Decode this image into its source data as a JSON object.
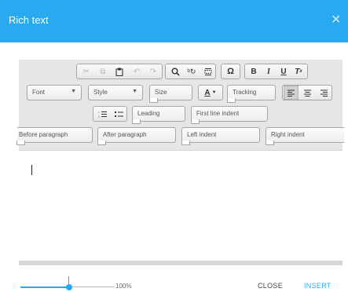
{
  "dialog": {
    "title": "Rich text"
  },
  "toolbar": {
    "font": "Font",
    "style": "Style",
    "size": "Size",
    "tracking": "Tracking",
    "leading": "Leading",
    "first_line_indent": "First line indent",
    "before_paragraph": "Before paragraph",
    "after_paragraph": "After paragraph",
    "left_indent": "Left indent",
    "right_indent": "Right indent",
    "bold": "B",
    "italic": "I",
    "underline": "U",
    "omega": "Ω",
    "text_color": "A",
    "icons": [
      "cut-icon",
      "copy-icon",
      "paste-icon",
      "undo-icon",
      "redo-icon",
      "search-icon",
      "replace-icon",
      "select-all-icon",
      "special-char-icon",
      "bold-icon",
      "italic-icon",
      "underline-icon",
      "remove-format-icon",
      "align-left-icon",
      "align-center-icon",
      "align-right-icon",
      "numbered-list-icon",
      "bulleted-list-icon"
    ]
  },
  "footer": {
    "zoom": "100%",
    "zoom_level": 0.5,
    "close": "CLOSE",
    "insert": "INSERT"
  },
  "colors": {
    "accent": "#29aaf0",
    "toolbar_bg": "#e6e6e6"
  }
}
